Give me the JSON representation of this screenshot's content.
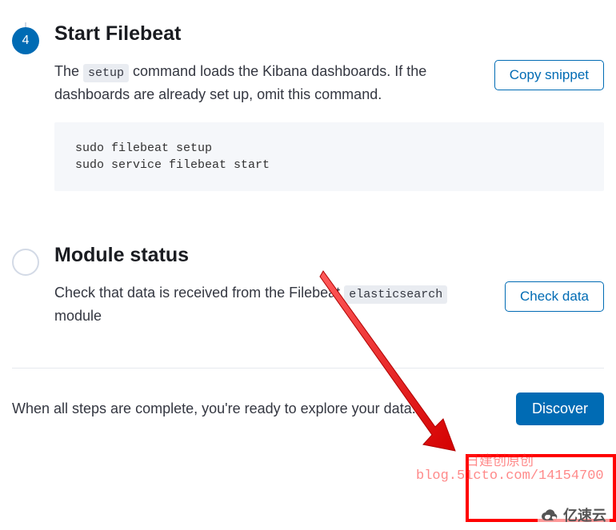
{
  "step4": {
    "number": "4",
    "title": "Start Filebeat",
    "desc_before": "The ",
    "desc_code": "setup",
    "desc_after": " command loads the Kibana dashboards. If the dashboards are already set up, omit this command.",
    "copy_btn": "Copy snippet",
    "snippet": "sudo filebeat setup\nsudo service filebeat start"
  },
  "step5": {
    "title": "Module status",
    "desc_before": "Check that data is received from the Filebeat ",
    "desc_code": "elasticsearch",
    "desc_after": " module",
    "check_btn": "Check data"
  },
  "footer": {
    "text": "When all steps are complete, you're ready to explore your data.",
    "discover_btn": "Discover"
  },
  "watermark": {
    "line1": "日建创原创",
    "line2": "blog.51cto.com/14154700"
  },
  "brand": "亿速云"
}
